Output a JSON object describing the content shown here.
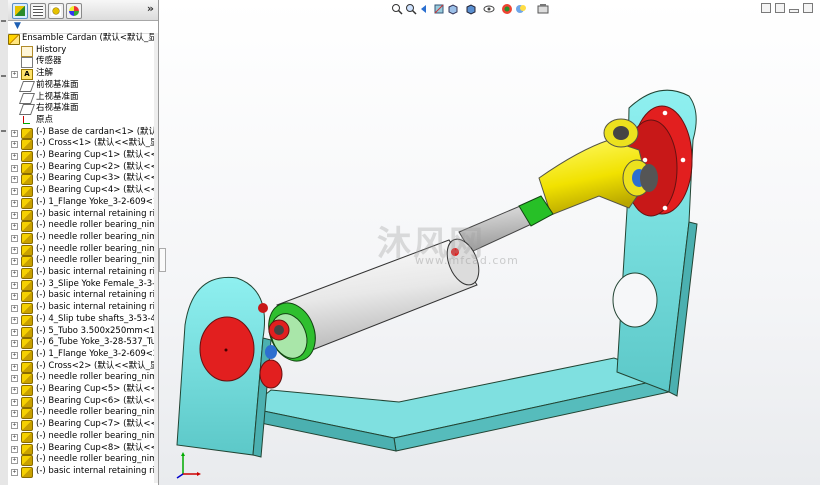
{
  "panel": {
    "expand_label": "»",
    "tabs": [
      {
        "icon": "feature-manager-icon",
        "active": true
      },
      {
        "icon": "property-manager-icon",
        "active": false
      },
      {
        "icon": "configuration-manager-icon",
        "active": false
      },
      {
        "icon": "display-manager-icon",
        "active": false
      }
    ],
    "filter_label": "▼"
  },
  "tree": {
    "root": "Ensamble Cardan  (默认<默认_显",
    "items": [
      {
        "label": "History",
        "icon": "history-icon",
        "exp": false
      },
      {
        "label": "传感器",
        "icon": "sensors-icon",
        "exp": false
      },
      {
        "label": "注解",
        "icon": "annotations-icon",
        "exp": true
      },
      {
        "label": "前视基准面",
        "icon": "plane-icon",
        "exp": false
      },
      {
        "label": "上视基准面",
        "icon": "plane-icon",
        "exp": false
      },
      {
        "label": "右视基准面",
        "icon": "plane-icon",
        "exp": false
      },
      {
        "label": "原点",
        "icon": "origin-icon",
        "exp": false
      },
      {
        "label": "(-) Base de cardan<1> (默认",
        "icon": "part-icon",
        "exp": true
      },
      {
        "label": "(-) Cross<1> (默认<<默认_显",
        "icon": "part-icon",
        "exp": true
      },
      {
        "label": "(-) Bearing Cup<1> (默认<<默",
        "icon": "part-icon",
        "exp": true
      },
      {
        "label": "(-) Bearing Cup<2> (默认<<默",
        "icon": "part-icon",
        "exp": true
      },
      {
        "label": "(-) Bearing Cup<3> (默认<<默",
        "icon": "part-icon",
        "exp": true
      },
      {
        "label": "(-) Bearing Cup<4> (默认<<默",
        "icon": "part-icon",
        "exp": true
      },
      {
        "label": "(-) 1_Flange Yoke_3-2-609<1",
        "icon": "part-icon",
        "exp": true
      },
      {
        "label": "(-) basic internal retaining rin",
        "icon": "part-icon",
        "exp": true
      },
      {
        "label": "(-) needle roller bearing_nim",
        "icon": "part-icon",
        "exp": true
      },
      {
        "label": "(-) needle roller bearing_nim",
        "icon": "part-icon",
        "exp": true
      },
      {
        "label": "(-) needle roller bearing_nim",
        "icon": "part-icon",
        "exp": true
      },
      {
        "label": "(-) needle roller bearing_nim",
        "icon": "part-icon",
        "exp": true
      },
      {
        "label": "(-) basic internal retaining rin",
        "icon": "part-icon",
        "exp": true
      },
      {
        "label": "(-) 3_Slipe Yoke Female_3-3-",
        "icon": "part-icon",
        "exp": true
      },
      {
        "label": "(-) basic internal retaining rin",
        "icon": "part-icon",
        "exp": true
      },
      {
        "label": "(-) basic internal retaining rin",
        "icon": "part-icon",
        "exp": true
      },
      {
        "label": "(-) 4_Slip tube shafts_3-53-41",
        "icon": "part-icon",
        "exp": true
      },
      {
        "label": "(-) 5_Tubo 3.500x250mm<1>",
        "icon": "part-icon",
        "exp": true
      },
      {
        "label": "(-) 6_Tube Yoke_3-28-537_Tu",
        "icon": "part-icon",
        "exp": true
      },
      {
        "label": "(-) 1_Flange Yoke_3-2-609<2",
        "icon": "part-icon",
        "exp": true
      },
      {
        "label": "(-) Cross<2> (默认<<默认_显",
        "icon": "part-icon",
        "exp": true
      },
      {
        "label": "(-) needle roller bearing_nim",
        "icon": "part-icon",
        "exp": true
      },
      {
        "label": "(-) Bearing Cup<5> (默认<<默",
        "icon": "part-icon",
        "exp": true
      },
      {
        "label": "(-) Bearing Cup<6> (默认<<默",
        "icon": "part-icon",
        "exp": true
      },
      {
        "label": "(-) needle roller bearing_nim",
        "icon": "part-icon",
        "exp": true
      },
      {
        "label": "(-) Bearing Cup<7> (默认<<默",
        "icon": "part-icon",
        "exp": true
      },
      {
        "label": "(-) needle roller bearing_nim",
        "icon": "part-icon",
        "exp": true
      },
      {
        "label": "(-) Bearing Cup<8> (默认<<默",
        "icon": "part-icon",
        "exp": true
      },
      {
        "label": "(-) needle roller bearing_nim",
        "icon": "part-icon",
        "exp": true
      },
      {
        "label": "(-) basic internal retaining rin",
        "icon": "part-icon",
        "exp": true
      }
    ]
  },
  "viewport": {
    "heads_up_icons": [
      "zoom-to-fit-icon",
      "zoom-area-icon",
      "previous-view-icon",
      "section-view-icon",
      "view-orientation-icon",
      "display-style-icon",
      "hide-show-icon",
      "edit-appearance-icon",
      "apply-scene-icon",
      "view-settings-icon"
    ],
    "window_controls": [
      "tile-icon",
      "restore-icon",
      "minimize-icon",
      "close-icon"
    ],
    "watermark": "沐风网",
    "watermark_url": "www.mfcad.com",
    "colors": {
      "base": "#7fe0e0",
      "flange": "#e21f1f",
      "yoke": "#f2e400",
      "tube": "#f2f2f2",
      "slip_ring": "#2fbf2f",
      "cross": "#1e6fd0"
    }
  }
}
